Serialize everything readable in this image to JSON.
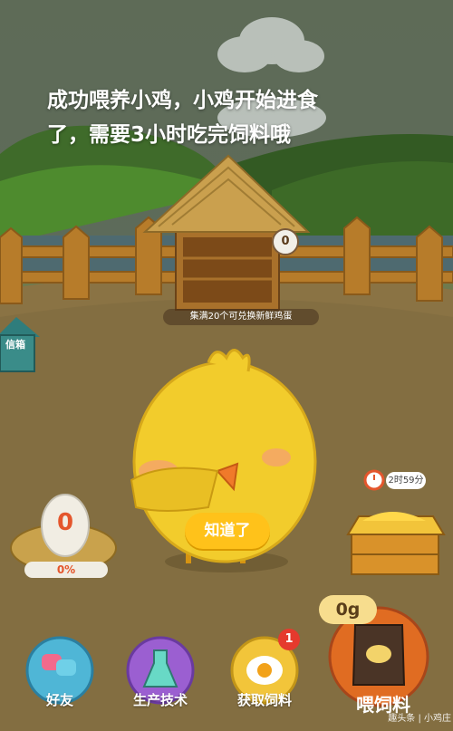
{
  "message": {
    "line1": "成功喂养小鸡，小鸡开始进食",
    "line2": "了，需要3小时吃完饲料哦"
  },
  "coop": {
    "egg_slot_count": "0",
    "caption": "集满20个可兑换新鲜鸡蛋"
  },
  "mailbox": {
    "label": "信箱"
  },
  "egg_nest": {
    "count": "0",
    "progress_text": "0%",
    "progress_fraction": 0
  },
  "dialog": {
    "confirm_label": "知道了"
  },
  "feeder": {
    "timer": "2时59分"
  },
  "feed": {
    "amount": "0g",
    "button_label": "喂饲料"
  },
  "bottom_bar": {
    "friends_label": "好友",
    "tech_label": "生产技术",
    "get_feed_label": "获取饲料",
    "get_feed_badge": "1"
  },
  "watermark": "趣头条 | 小鸡庄",
  "colors": {
    "accent_yellow": "#ffc21a",
    "egg_red": "#e4562c",
    "badge_red": "#e53a2d",
    "ground": "#c9a46a"
  },
  "icons": [
    "mailbox-icon",
    "egg-icon",
    "chick-character",
    "feed-crate-icon",
    "friends-icon",
    "flask-icon",
    "fried-egg-icon",
    "feed-sack-icon",
    "alarm-clock-icon"
  ]
}
